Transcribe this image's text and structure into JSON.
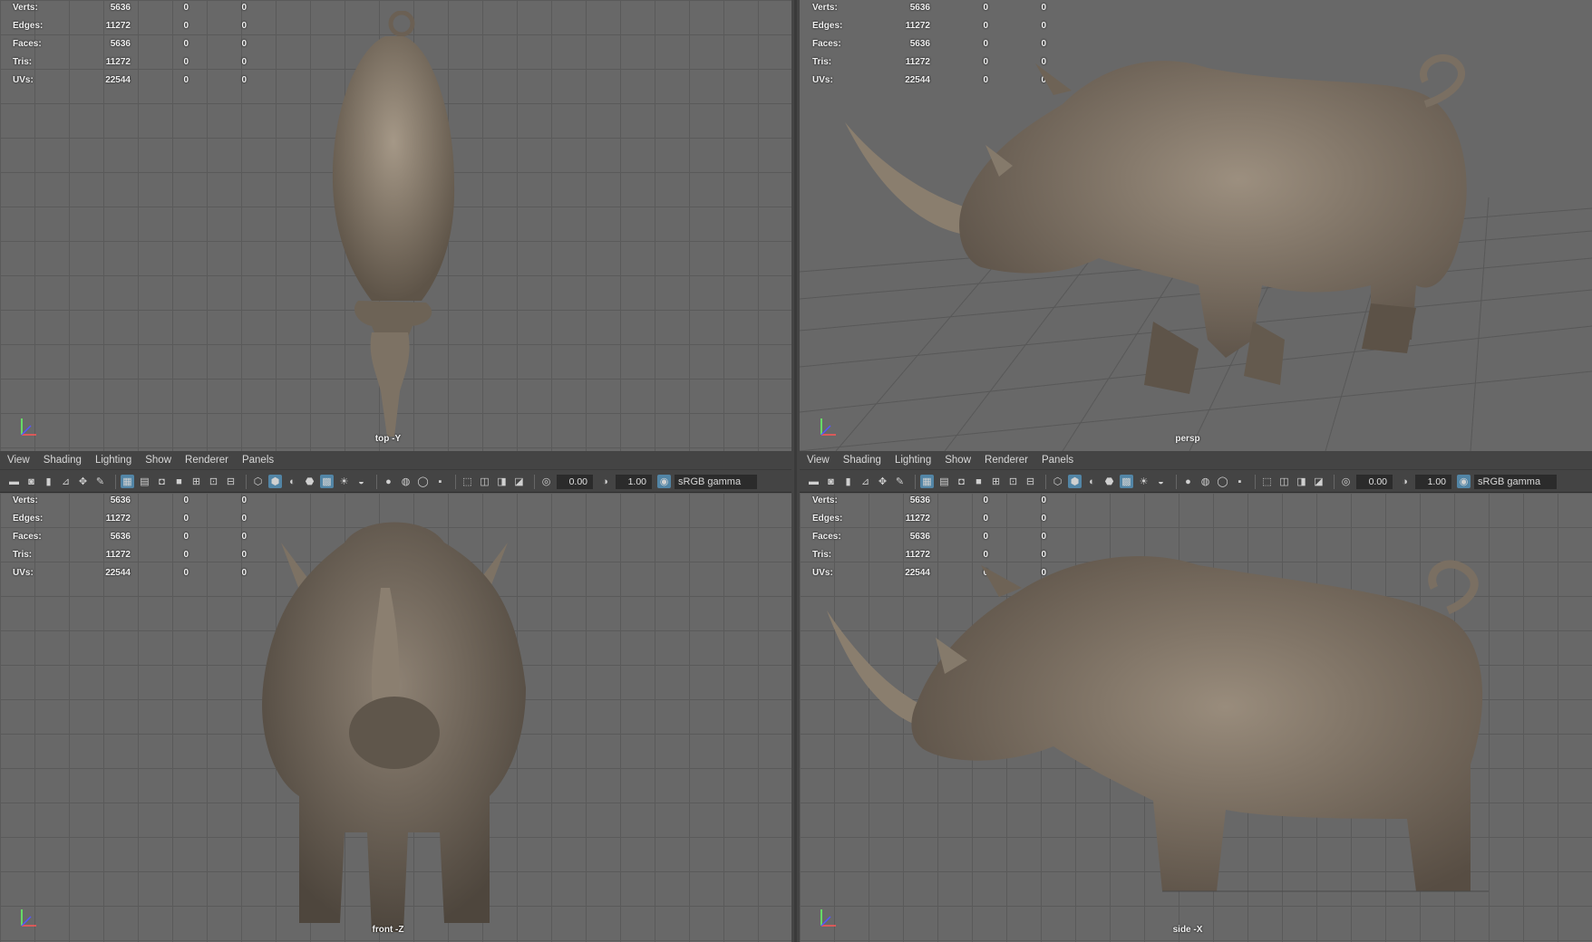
{
  "viewports": {
    "top": {
      "camera": "top -Y"
    },
    "persp": {
      "camera": "persp"
    },
    "front": {
      "camera": "front -Z"
    },
    "side": {
      "camera": "side -X"
    }
  },
  "hud": [
    {
      "label": "Verts:",
      "value": "5636",
      "z1": "0",
      "z2": "0"
    },
    {
      "label": "Edges:",
      "value": "11272",
      "z1": "0",
      "z2": "0"
    },
    {
      "label": "Faces:",
      "value": "5636",
      "z1": "0",
      "z2": "0"
    },
    {
      "label": "Tris:",
      "value": "11272",
      "z1": "0",
      "z2": "0"
    },
    {
      "label": "UVs:",
      "value": "22544",
      "z1": "0",
      "z2": "0"
    }
  ],
  "menu": [
    "View",
    "Shading",
    "Lighting",
    "Show",
    "Renderer",
    "Panels"
  ],
  "toolbar": {
    "field1": "0.00",
    "field2": "1.00",
    "colorspace": "sRGB gamma"
  },
  "colors": {
    "viewport_bg": "#686868",
    "grid": "#5a5a5a",
    "panel_bg": "#444444",
    "accent": "#5285a6"
  }
}
